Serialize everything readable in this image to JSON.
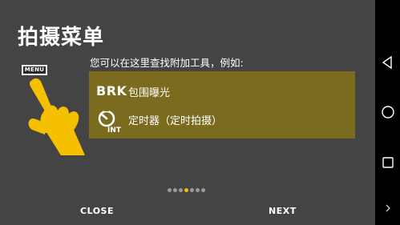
{
  "title": "拍摄菜单",
  "menu_key_label": "MENU",
  "intro_text": "您可以在这里查找附加工具，例如:",
  "panel": {
    "row1": {
      "badge": "BRK",
      "label": "包围曝光"
    },
    "row2": {
      "badge": "INT",
      "label": "定时器（定时拍摄）"
    }
  },
  "pagination": {
    "total": 7,
    "active_index": 3
  },
  "buttons": {
    "close": "CLOSE",
    "next": "NEXT"
  },
  "colors": {
    "background": "#444444",
    "panel": "#7a6b1e",
    "hand": "#f5c000",
    "active_dot": "#f0c000"
  },
  "icons": {
    "hand": "pointing-hand-icon",
    "timer": "self-timer-icon",
    "back": "triangle-back-icon",
    "home": "circle-home-icon",
    "recent": "square-recent-icon",
    "more": "chevron-right-icon"
  }
}
